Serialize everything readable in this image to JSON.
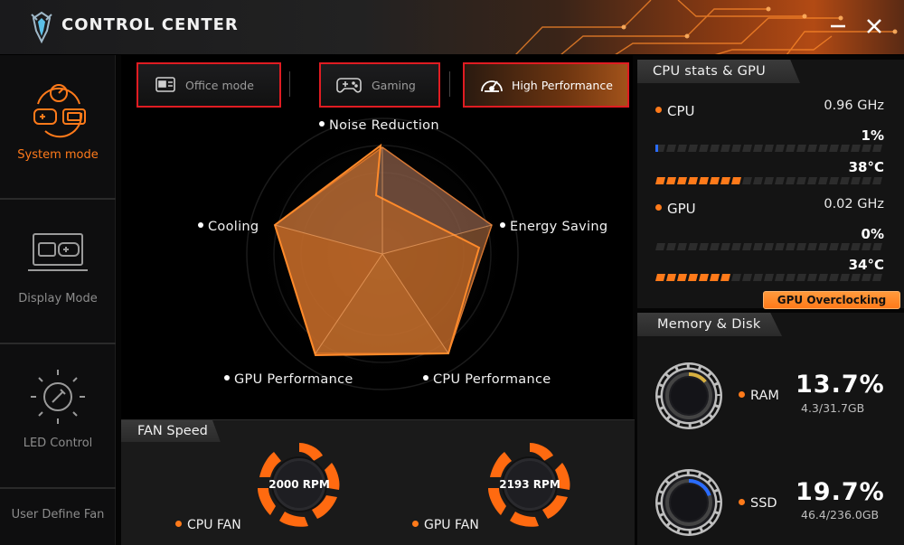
{
  "app": {
    "title": "CONTROL CENTER"
  },
  "window": {
    "minimize_icon": "minimize-icon",
    "close_icon": "close-icon"
  },
  "sidebar": {
    "items": [
      {
        "label": "System mode",
        "icon": "system-mode-icon",
        "active": true
      },
      {
        "label": "Display Mode",
        "icon": "display-mode-icon",
        "active": false
      },
      {
        "label": "LED Control",
        "icon": "led-control-icon",
        "active": false
      },
      {
        "label": "User Define Fan",
        "icon": "",
        "active": false
      }
    ]
  },
  "modes": [
    {
      "label": "Office mode",
      "icon": "office-mode-icon",
      "active": false
    },
    {
      "label": "Gaming",
      "icon": "gamepad-icon",
      "active": false
    },
    {
      "label": "High Performance",
      "icon": "speedometer-icon",
      "active": true
    }
  ],
  "radar": {
    "axes": [
      "Noise Reduction",
      "Energy Saving",
      "CPU Performance",
      "GPU Performance",
      "Cooling"
    ]
  },
  "fan": {
    "title": "FAN Speed",
    "cpu": {
      "label": "CPU FAN",
      "rpm": "2000 RPM"
    },
    "gpu": {
      "label": "GPU FAN",
      "rpm": "2193 RPM"
    }
  },
  "stats": {
    "title": "CPU stats & GPU stats",
    "cpu": {
      "label": "CPU",
      "freq": "0.96 GHz",
      "usage": "1%",
      "usage_fraction": 0.01,
      "temp": "38°C",
      "temp_fraction": 0.38
    },
    "gpu": {
      "label": "GPU",
      "freq": "0.02 GHz",
      "usage": "0%",
      "usage_fraction": 0.0,
      "temp": "34°C",
      "temp_fraction": 0.34
    },
    "overclock_label": "GPU Overclocking"
  },
  "memory": {
    "title": "Memory & Disk",
    "ram": {
      "label": "RAM",
      "percent": "13.7%",
      "detail": "4.3/31.7GB",
      "fraction": 0.137
    },
    "ssd": {
      "label": "SSD",
      "percent": "19.7%",
      "detail": "46.4/236.0GB",
      "fraction": 0.197
    }
  },
  "colors": {
    "accent": "#ff7a1a",
    "highlight": "#e01c22",
    "ssd_ring": "#2a6cff"
  }
}
